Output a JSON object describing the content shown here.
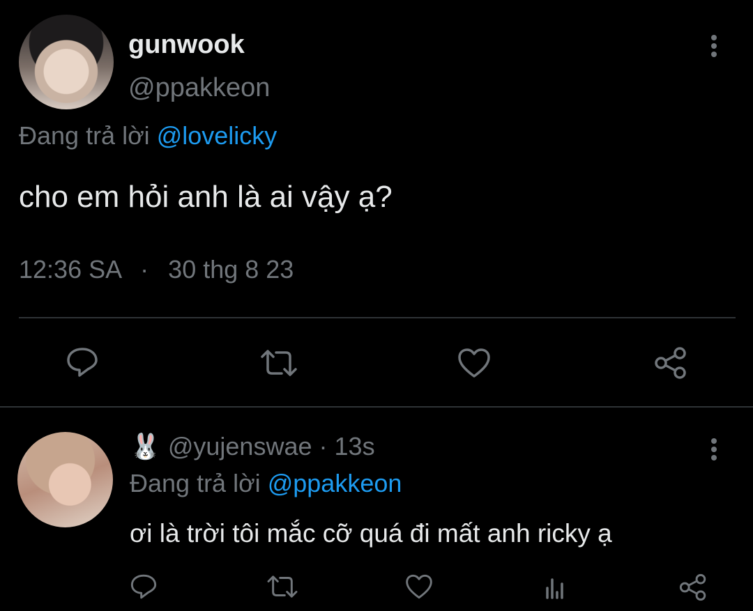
{
  "tweet": {
    "display_name": "gunwook",
    "handle": "@ppakkeon",
    "replying_prefix": "Đang trả lời",
    "replying_to": "@lovelicky",
    "text": "cho em hỏi anh là ai vậy ạ?",
    "time": "12:36 SA",
    "separator": "·",
    "date": "30 thg 8 23"
  },
  "reply": {
    "emoji": "🐰",
    "handle": "@yujenswae",
    "separator": "·",
    "age": "13s",
    "replying_prefix": "Đang trả lời",
    "replying_to": "@ppakkeon",
    "text": "ơi là trời tôi mắc cỡ quá đi mất anh ricky ạ"
  },
  "colors": {
    "background": "#000000",
    "text": "#e7e9ea",
    "muted": "#71767b",
    "link": "#1d9bf0",
    "divider": "#2f3336"
  },
  "icons": {
    "more": "more-vertical-icon",
    "reply": "reply-icon",
    "retweet": "retweet-icon",
    "like": "heart-icon",
    "views": "views-icon",
    "share": "share-icon"
  }
}
